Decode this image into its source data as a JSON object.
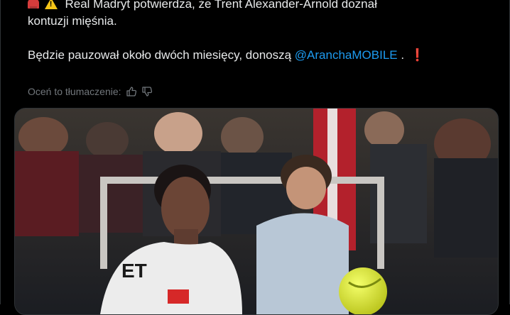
{
  "tweet": {
    "line1": "Real Madryt potwierdza, że Trent Alexander-Arnold doznał",
    "line2": "kontuzji mięśnia.",
    "line3_prefix": "Będzie pauzował około dwóch miesięcy, donoszą ",
    "mention": "@AranchaMOBILE",
    "line3_suffix": " .",
    "exclamation": "❗",
    "emoji_1": "police-car-light-icon",
    "emoji_2": "warning-icon"
  },
  "translation": {
    "label": "Oceń to tłumaczenie:",
    "thumbs_up": "thumbs-up-icon",
    "thumbs_down": "thumbs-down-icon"
  },
  "media": {
    "jersey_text": "ET"
  },
  "colors": {
    "background": "#000000",
    "text": "#e7e9ea",
    "muted": "#71767b",
    "link": "#1d9bf0",
    "alert": "#e02424"
  }
}
